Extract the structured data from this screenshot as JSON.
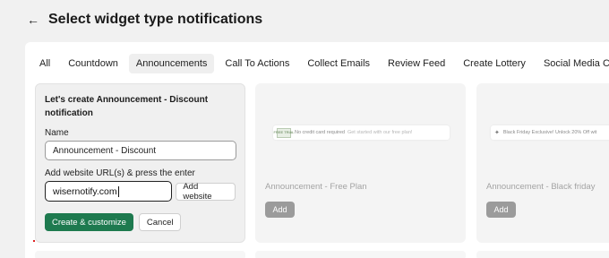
{
  "header": {
    "title": "Select widget type notifications",
    "back_icon": "arrow-left-icon"
  },
  "tabs": [
    {
      "label": "All",
      "active": false
    },
    {
      "label": "Countdown",
      "active": false
    },
    {
      "label": "Announcements",
      "active": true
    },
    {
      "label": "Call To Actions",
      "active": false
    },
    {
      "label": "Collect Emails",
      "active": false
    },
    {
      "label": "Review Feed",
      "active": false
    },
    {
      "label": "Create Lottery",
      "active": false
    },
    {
      "label": "Social Media Counter",
      "active": false
    }
  ],
  "form": {
    "heading": "Let's create Announcement - Discount notification",
    "name_label": "Name",
    "name_value": "Announcement - Discount",
    "url_label": "Add website URL(s) & press the enter",
    "url_value": "wisernotify.com",
    "add_website_label": "Add website",
    "create_label": "Create & customize",
    "cancel_label": "Cancel"
  },
  "cards": [
    {
      "title": "Announcement - Free Plan",
      "preview_badge": "FREE TRIAL",
      "preview_text": "No credit card required",
      "preview_subtext": "Get started with our free plan!",
      "add_label": "Add"
    },
    {
      "title": "Announcement - Black friday",
      "preview_text": "Black Friday Exclusive! Unlock 20% Off wit",
      "add_label": "Add"
    }
  ],
  "colors": {
    "primary": "#1e7a4f",
    "background": "#f1f1f1",
    "disabled_button": "#9b9b9b"
  }
}
